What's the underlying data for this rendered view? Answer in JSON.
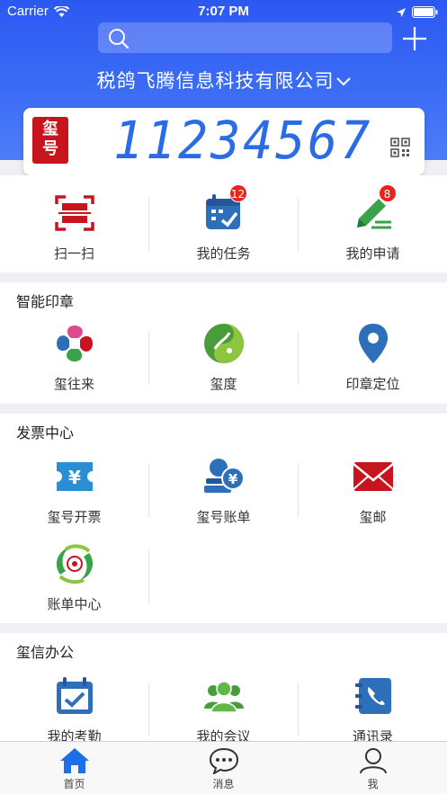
{
  "status_bar": {
    "carrier": "Carrier",
    "time": "7:07 PM"
  },
  "header": {
    "company": "税鸽飞腾信息科技有限公司",
    "seal_text": "玺号",
    "number": "11234567"
  },
  "quick_actions": [
    {
      "label": "扫一扫"
    },
    {
      "label": "我的任务",
      "badge": "12"
    },
    {
      "label": "我的申请",
      "badge": "8"
    }
  ],
  "sections": {
    "smart_seal": {
      "title": "智能印章",
      "items": [
        "玺往来",
        "玺度",
        "印章定位"
      ]
    },
    "invoice": {
      "title": "发票中心",
      "items": [
        "玺号开票",
        "玺号账单",
        "玺邮",
        "账单中心"
      ]
    },
    "office": {
      "title": "玺信办公",
      "items": [
        "我的考勤",
        "我的会议",
        "通讯录"
      ]
    }
  },
  "tabbar": [
    {
      "label": "首页"
    },
    {
      "label": "消息"
    },
    {
      "label": "我"
    }
  ],
  "colors": {
    "brand_blue": "#2c58f2",
    "accent_red": "#c8141e",
    "badge_red": "#e8241c",
    "active_tab": "#1d6fe8"
  }
}
